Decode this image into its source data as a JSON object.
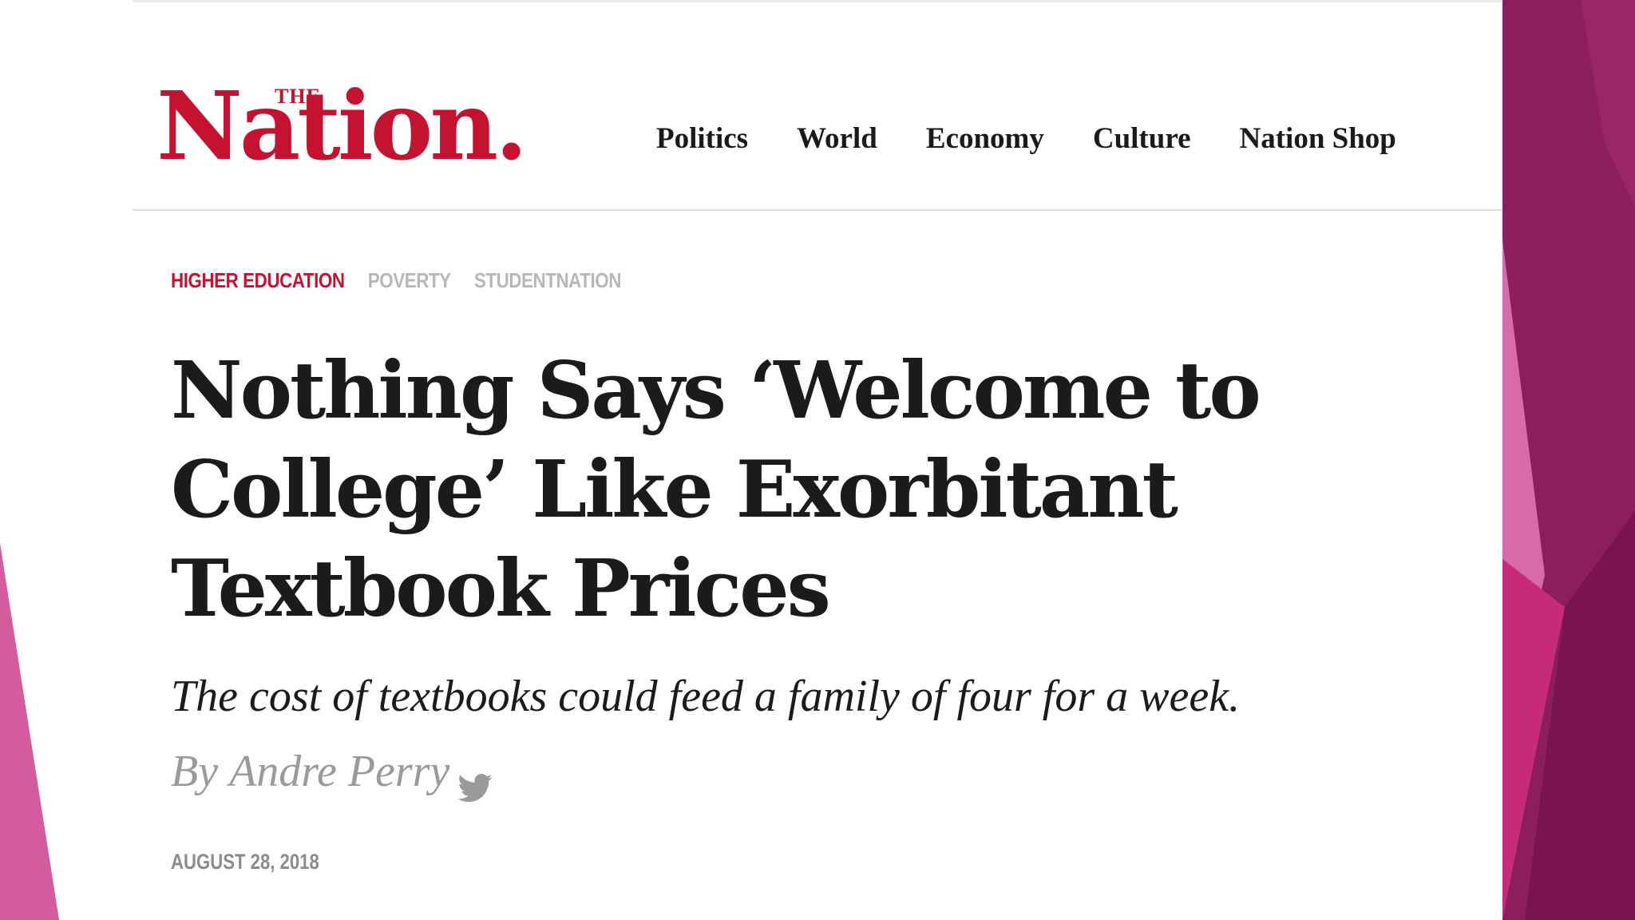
{
  "logo": {
    "small_text": "THE",
    "word": "Nation."
  },
  "nav": {
    "items": [
      {
        "label": "Politics"
      },
      {
        "label": "World"
      },
      {
        "label": "Economy"
      },
      {
        "label": "Culture"
      },
      {
        "label": "Nation Shop"
      }
    ]
  },
  "tags": [
    {
      "label": "HIGHER EDUCATION"
    },
    {
      "label": "POVERTY"
    },
    {
      "label": "STUDENTNATION"
    }
  ],
  "article": {
    "headline": "Nothing Says ‘Welcome to College’ Like Exorbitant Textbook Prices",
    "dek": "The cost of textbooks could feed a family of four for a week.",
    "byline_prefix": "By",
    "author": "Andre Perry",
    "date": "AUGUST 28, 2018"
  },
  "icons": {
    "social": "twitter-icon"
  },
  "colors": {
    "brand_red": "#c41230",
    "slide_magenta_dark": "#8a1a5c",
    "slide_magenta": "#c4286e",
    "slide_pink": "#d96aa6"
  }
}
